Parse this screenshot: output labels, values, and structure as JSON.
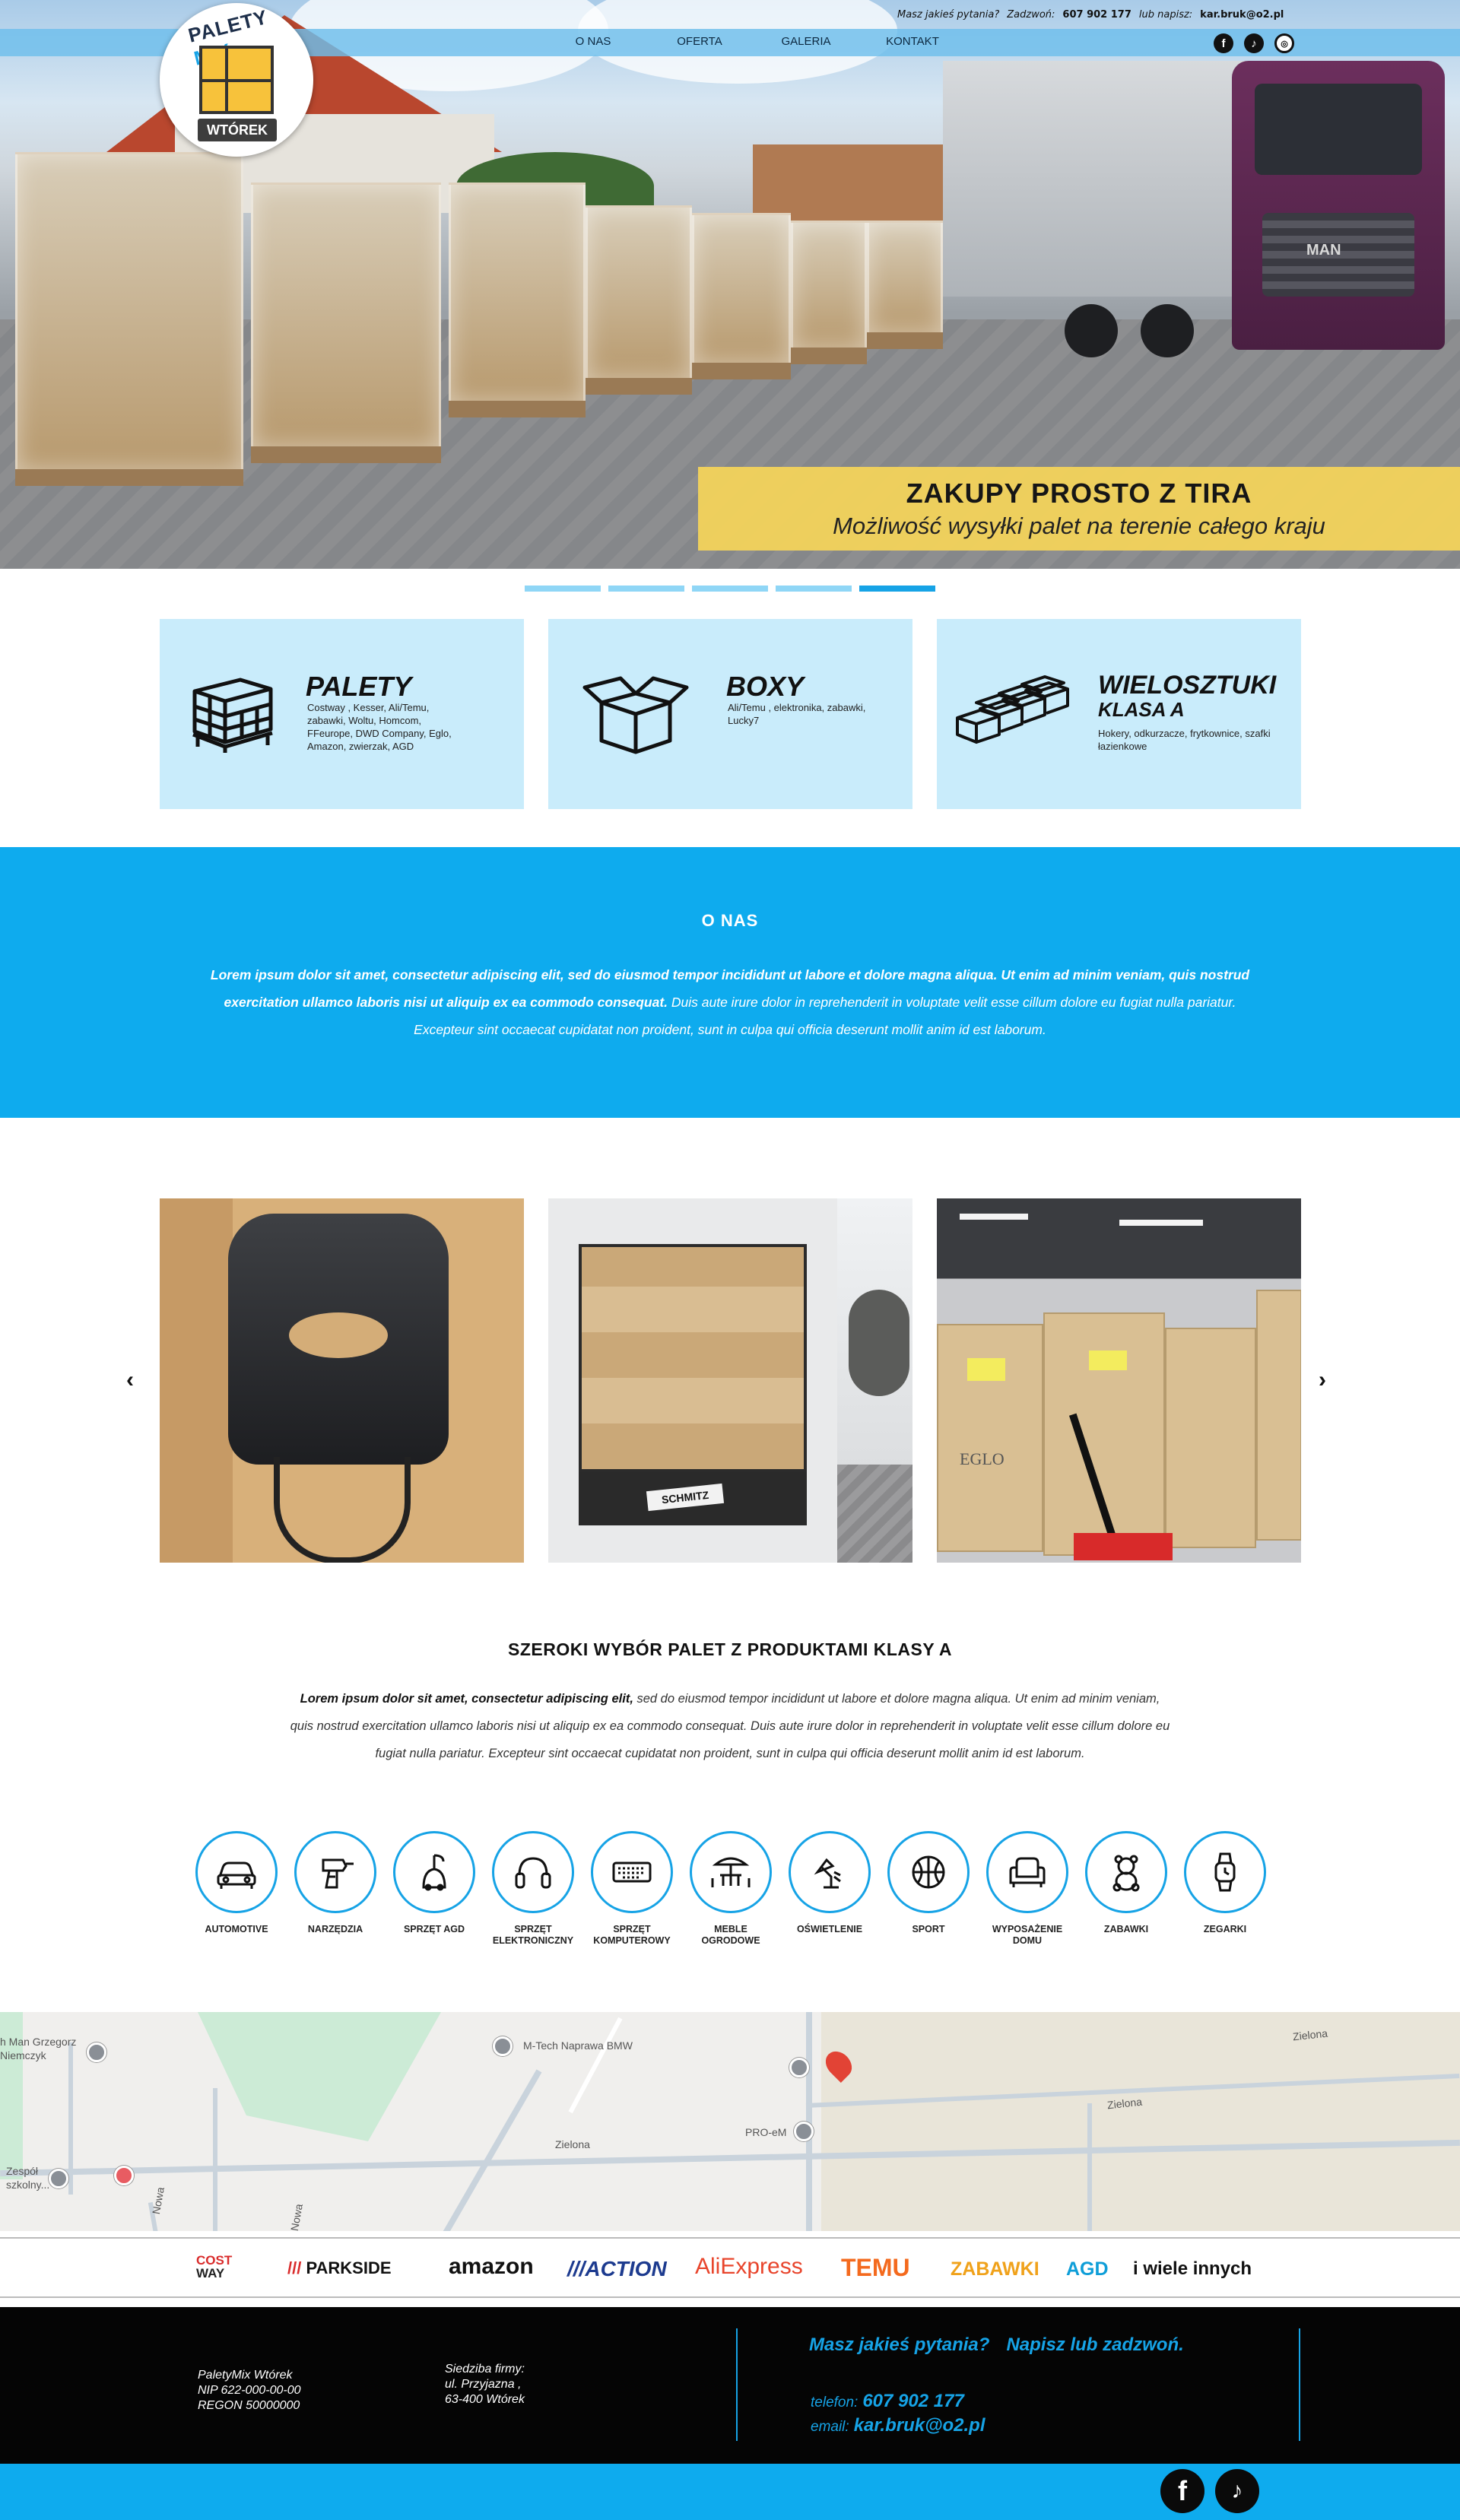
{
  "topbar": {
    "question": "Masz jakieś pytania?",
    "call_label": "Zadzwoń:",
    "phone": "607 902 177",
    "write_label": "lub napisz:",
    "email": "kar.bruk@o2.pl"
  },
  "nav": {
    "items": [
      {
        "label": "O NAS"
      },
      {
        "label": "OFERTA"
      },
      {
        "label": "GALERIA"
      },
      {
        "label": "KONTAKT"
      }
    ]
  },
  "logo": {
    "top_text": "PALETY",
    "top_accent": "MIX",
    "tag": "WTÓREK"
  },
  "hero": {
    "truck_brand": "MAN",
    "banner_title": "ZAKUPY PROSTO Z TIRA",
    "banner_subtitle": "Możliwość wysyłki palet na terenie całego kraju",
    "slides_total": 5,
    "active_slide": 5
  },
  "categories": [
    {
      "title": "PALETY",
      "subtitle": "",
      "desc": "Costway , Kesser, Ali/Temu, zabawki, Woltu, Homcom, FFeurope, DWD Company, Eglo, Amazon, zwierzak, AGD",
      "icon": "pallet-icon"
    },
    {
      "title": "BOXY",
      "subtitle": "",
      "desc": "Ali/Temu , elektronika, zabawki, Lucky7",
      "icon": "box-icon"
    },
    {
      "title": "WIELOSZTUKI",
      "subtitle": "KLASA A",
      "desc": "Hokery, odkurzacze, frytkownice, szafki łazienkowe",
      "icon": "boxes-icon"
    }
  ],
  "about": {
    "title": "O NAS",
    "text_bold": "Lorem ipsum dolor sit amet, consectetur adipiscing elit, sed do eiusmod tempor incididunt ut labore et dolore magna aliqua. Ut enim ad minim veniam, quis nostrud exercitation ullamco laboris nisi ut aliquip ex ea commodo consequat.",
    "text_rest": " Duis aute irure dolor in reprehenderit in voluptate velit esse cillum dolore eu fugiat nulla pariatur. Excepteur sint occaecat cupidatat non proident, sunt in culpa qui officia deserunt mollit anim id est laborum."
  },
  "gallery": {
    "prev": "‹",
    "next": "›",
    "truck_plate": "SCHMITZ",
    "box_brand": "EGLO"
  },
  "products": {
    "title": "SZEROKI WYBÓR PALET Z PRODUKTAMI KLASY A",
    "text_bold": "Lorem ipsum dolor sit amet, consectetur adipiscing elit,",
    "text_rest": " sed do eiusmod tempor incididunt ut labore et dolore magna aliqua. Ut enim ad minim veniam, quis nostrud exercitation ullamco laboris nisi ut aliquip ex ea commodo consequat. Duis aute irure dolor in reprehenderit in voluptate velit esse cillum dolore eu fugiat nulla pariatur. Excepteur sint occaecat cupidatat non proident, sunt in culpa qui officia deserunt mollit anim id est laborum.",
    "items": [
      {
        "label": "AUTOMOTIVE",
        "icon": "car-icon"
      },
      {
        "label": "NARZĘDZIA",
        "icon": "drill-icon"
      },
      {
        "label": "SPRZĘT AGD",
        "icon": "vacuum-icon"
      },
      {
        "label": "SPRZĘT ELEKTRONICZNY",
        "icon": "headphones-icon"
      },
      {
        "label": "SPRZĘT KOMPUTEROWY",
        "icon": "keyboard-icon"
      },
      {
        "label": "MEBLE OGRODOWE",
        "icon": "garden-table-icon"
      },
      {
        "label": "OŚWIETLENIE",
        "icon": "lamp-icon"
      },
      {
        "label": "SPORT",
        "icon": "ball-icon"
      },
      {
        "label": "WYPOSAŻENIE DOMU",
        "icon": "armchair-icon"
      },
      {
        "label": "ZABAWKI",
        "icon": "teddy-icon"
      },
      {
        "label": "ZEGARKI",
        "icon": "watch-icon"
      }
    ]
  },
  "map": {
    "labels": {
      "man": "h Man Grzegorz Niemczyk",
      "mtech": "M-Tech Naprawa BMW",
      "proem": "PRO-eM",
      "zielona1": "Zielona",
      "zielona2": "Zielona",
      "zielona3": "Zielona",
      "school": "Zespół szkolny...",
      "nowa1": "Nowa",
      "nowa2": "Nowa"
    }
  },
  "brands": {
    "costway_top": "COST",
    "costway_bottom": "WAY",
    "parkside": "PARKSIDE",
    "amazon": "amazon",
    "action": "ACTION",
    "aliexpress": "AliExpress",
    "temu": "TEMU",
    "zabawki": "ZABAWKI",
    "agd": "AGD",
    "more": "i wiele innych"
  },
  "footer": {
    "company_name": "PaletyMix Wtórek",
    "nip": "NIP 622-000-00-00",
    "regon": "REGON 50000000",
    "address_label": "Siedziba firmy:",
    "street": "ul. Przyjazna ,",
    "city": "63-400 Wtórek",
    "question": "Masz jakieś pytania?",
    "cta": "Napisz lub zadzwoń.",
    "phone_label": "telefon:",
    "phone": "607 902 177",
    "email_label": "email:",
    "email": "kar.bruk@o2.pl"
  },
  "colors": {
    "accent_blue": "#0eabee",
    "card_bg": "#c9ecfb",
    "banner_yellow": "#f6d559",
    "footer_bg": "#050505"
  }
}
